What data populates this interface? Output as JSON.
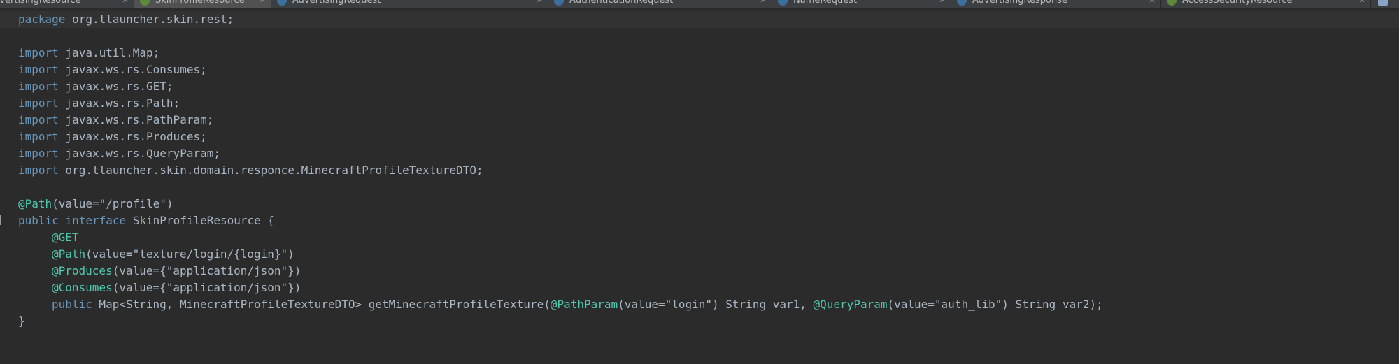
{
  "tabs": [
    {
      "label": "...AdvertisingResource",
      "active": false
    },
    {
      "label": "SkinProfileResource",
      "active": true
    },
    {
      "label": "AdvertisingRequest",
      "active": false
    },
    {
      "label": "AuthenticationRequest",
      "active": false
    },
    {
      "label": "NameRequest",
      "active": false
    },
    {
      "label": "AdvertisingResponse",
      "active": false
    },
    {
      "label": "AccessSecurityResource",
      "active": false
    }
  ],
  "code": {
    "package_kw": "package",
    "package_name": " org.tlauncher.skin.rest;",
    "import_kw": "import",
    "imports": [
      " java.util.Map;",
      " javax.ws.rs.Consumes;",
      " javax.ws.rs.GET;",
      " javax.ws.rs.Path;",
      " javax.ws.rs.PathParam;",
      " javax.ws.rs.Produces;",
      " javax.ws.rs.QueryParam;",
      " org.tlauncher.skin.domain.responce.MinecraftProfileTextureDTO;"
    ],
    "class_path_ann": "@Path",
    "class_path_val": "(value=\"/profile\")",
    "public_kw": "public",
    "interface_kw": "interface",
    "interface_name": " SkinProfileResource {",
    "get_ann": "@GET",
    "path_ann": "@Path",
    "path_val": "(value=\"texture/login/{login}\")",
    "produces_ann": "@Produces",
    "produces_val": "(value={\"application/json\"})",
    "consumes_ann": "@Consumes",
    "consumes_val": "(value={\"application/json\"})",
    "method_pre": " Map<String, MinecraftProfileTextureDTO> getMinecraftProfileTexture(",
    "pathparam_ann": "@PathParam",
    "pathparam_val": "(value=\"login\") String var1, ",
    "queryparam_ann": "@QueryParam",
    "queryparam_val": "(value=\"auth_lib\") String var2);",
    "close_brace": "}"
  },
  "colors": {
    "keyword": "#6897bb",
    "annotation": "#4ec9b0",
    "text": "#a9b7c6",
    "background": "#2b2b2b"
  },
  "icons": {
    "java_file": "java-class-icon",
    "close": "close-icon"
  }
}
